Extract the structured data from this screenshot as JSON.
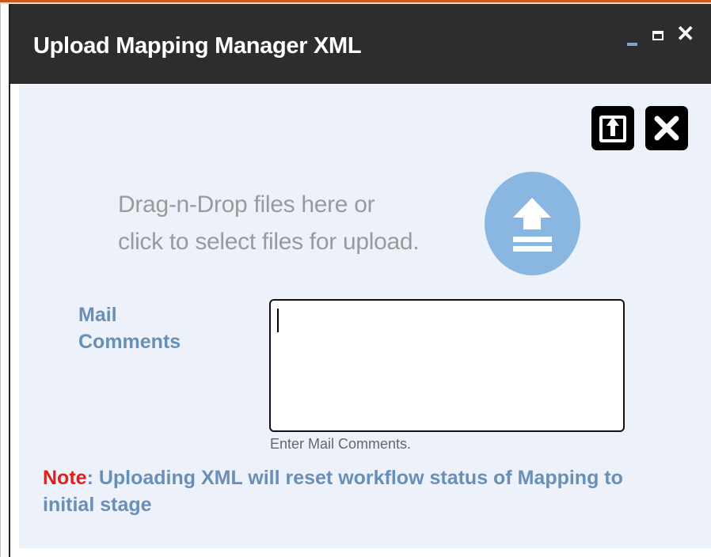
{
  "window": {
    "title": "Upload Mapping Manager XML",
    "controls": [
      "minimize-icon",
      "maximize-icon",
      "close-icon"
    ],
    "close_glyph": "✕"
  },
  "toolbar": {
    "upload_icon": "upload-arrow-icon",
    "clear_icon": "close-icon"
  },
  "dropzone": {
    "line1": "Drag-n-Drop files here or",
    "line2": "click to select files for upload.",
    "icon": "upload-circle-icon"
  },
  "mail": {
    "label_line1": "Mail",
    "label_line2": "Comments",
    "value": "",
    "hint": "Enter Mail Comments."
  },
  "note": {
    "label": "Note",
    "text": ": Uploading XML will reset workflow status of Mapping to initial stage"
  },
  "colors": {
    "titlebar": "#2d2d2d",
    "content_bg": "#edf2fa",
    "label_blue": "#6a8fb6",
    "note_red": "#e0201a",
    "upload_circle": "#8ab7e2",
    "accent": "#c85a1e"
  }
}
